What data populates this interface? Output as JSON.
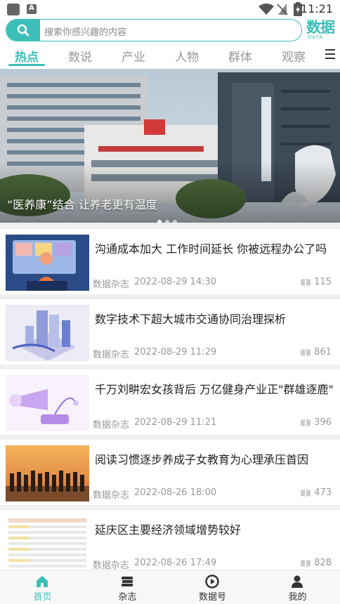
{
  "status_bar": {
    "time": "11:21"
  },
  "search": {
    "placeholder": "搜索你感兴趣的内容"
  },
  "logo": {
    "text": "数据",
    "subtext": "DATA"
  },
  "tabs": [
    {
      "label": "热点",
      "active": true
    },
    {
      "label": "数说"
    },
    {
      "label": "产业"
    },
    {
      "label": "人物"
    },
    {
      "label": "群体"
    },
    {
      "label": "观察"
    }
  ],
  "banner": {
    "caption": "“医养康”结合 让养老更有温度",
    "page_indicator": {
      "current": 1,
      "total": 3
    }
  },
  "articles": [
    {
      "title": "沟通成本加大 工作时间延长 你被远程办公了吗",
      "source": "数据杂志",
      "date": "2022-08-29 14:30",
      "views": "115"
    },
    {
      "title": "数字技术下超大城市交通协同治理探析",
      "source": "数据杂志",
      "date": "2022-08-29 11:29",
      "views": "861"
    },
    {
      "title": "千万刘畊宏女孩背后 万亿健身产业正\"群雄逐鹿\"",
      "source": "数据杂志",
      "date": "2022-08-29 11:21",
      "views": "396"
    },
    {
      "title": "阅读习惯逐步养成子女教育为心理承压首因",
      "source": "数据杂志",
      "date": "2022-08-26 18:00",
      "views": "473"
    },
    {
      "title": "延庆区主要经济领域增势较好",
      "source": "数据杂志",
      "date": "2022-08-26 17:49",
      "views": "828"
    }
  ],
  "bottom_nav": [
    {
      "label": "首页",
      "icon": "home-icon",
      "active": true
    },
    {
      "label": "杂志",
      "icon": "books-icon"
    },
    {
      "label": "数据号",
      "icon": "data-channel-icon"
    },
    {
      "label": "我的",
      "icon": "person-icon"
    }
  ],
  "colors": {
    "accent": "#3bbfb8",
    "text": "#222222",
    "muted": "#999999"
  }
}
